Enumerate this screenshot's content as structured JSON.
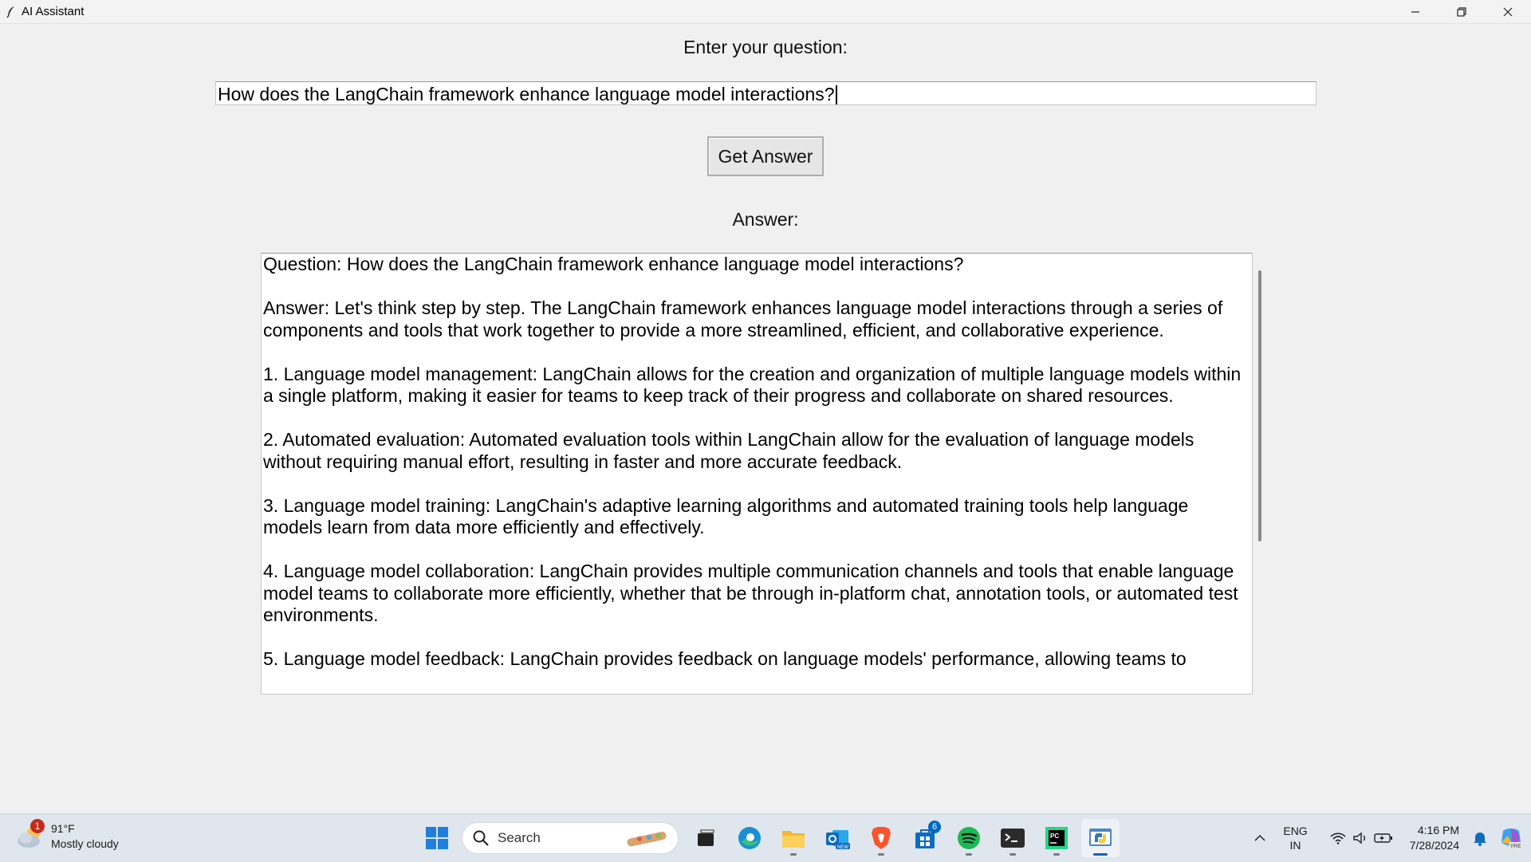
{
  "window": {
    "title": "AI Assistant"
  },
  "form": {
    "prompt_label": "Enter your question:",
    "question_value": "How does the LangChain framework enhance language model interactions?",
    "button_label": "Get Answer",
    "answer_label": "Answer:",
    "answer_text": "Question: How does the LangChain framework enhance language model interactions?\n\nAnswer: Let's think step by step. The LangChain framework enhances language model interactions through a series of components and tools that work together to provide a more streamlined, efficient, and collaborative experience.\n\n1. Language model management: LangChain allows for the creation and organization of multiple language models within a single platform, making it easier for teams to keep track of their progress and collaborate on shared resources.\n\n2. Automated evaluation: Automated evaluation tools within LangChain allow for the evaluation of language models without requiring manual effort, resulting in faster and more accurate feedback.\n\n3. Language model training: LangChain's adaptive learning algorithms and automated training tools help language models learn from data more efficiently and effectively.\n\n4. Language model collaboration: LangChain provides multiple communication channels and tools that enable language model teams to collaborate more efficiently, whether that be through in-platform chat, annotation tools, or automated test environments.\n\n5. Language model feedback: LangChain provides feedback on language models' performance, allowing teams to"
  },
  "taskbar": {
    "weather": {
      "badge": "1",
      "temp": "91°F",
      "condition": "Mostly cloudy",
      "icon": "cloud-icon"
    },
    "search_label": "Search",
    "apps": [
      {
        "name": "start",
        "icon": "windows-logo-icon"
      },
      {
        "name": "task-view",
        "icon": "task-view-icon"
      },
      {
        "name": "edge",
        "icon": "edge-icon"
      },
      {
        "name": "file-explorer",
        "icon": "folder-icon"
      },
      {
        "name": "outlook-new",
        "icon": "outlook-icon"
      },
      {
        "name": "brave",
        "icon": "brave-icon"
      },
      {
        "name": "store",
        "icon": "store-icon",
        "badge": "6"
      },
      {
        "name": "spotify",
        "icon": "spotify-icon"
      },
      {
        "name": "terminal",
        "icon": "terminal-icon"
      },
      {
        "name": "pycharm",
        "icon": "pycharm-icon"
      },
      {
        "name": "python-app",
        "icon": "python-icon"
      }
    ],
    "lang_top": "ENG",
    "lang_bottom": "IN",
    "time": "4:16 PM",
    "date": "7/28/2024"
  },
  "colors": {
    "accent": "#0067c0",
    "badge_red": "#c42b1c"
  }
}
